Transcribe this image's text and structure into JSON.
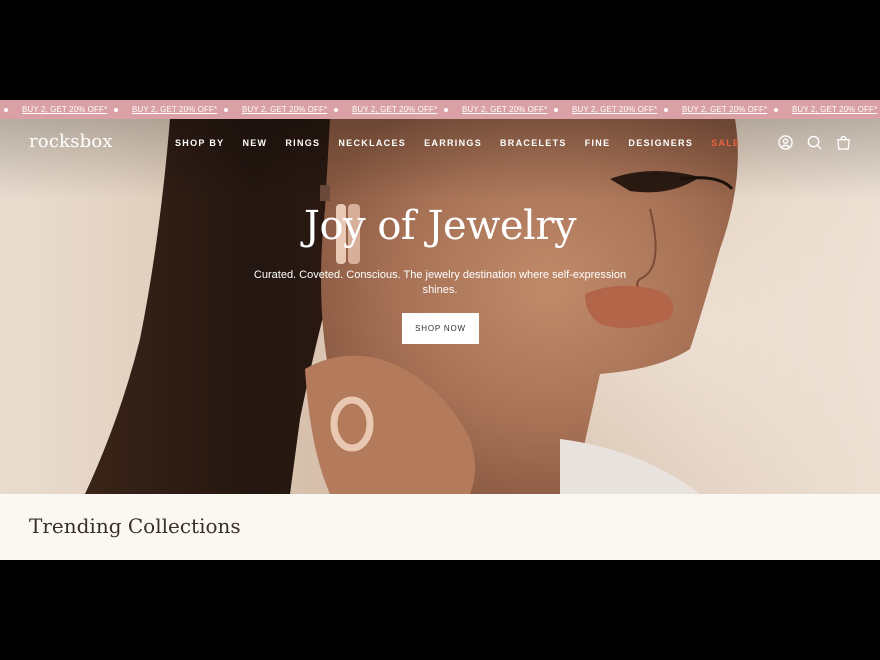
{
  "promo_bar": {
    "items": [
      "BUY 2, GET 20% OFF*",
      "BUY 2, GET 20% OFF*",
      "BUY 2, GET 20% OFF*",
      "BUY 2, GET 20% OFF*",
      "BUY 2, GET 20% OFF*",
      "BUY 2, GET 20% OFF*",
      "BUY 2, GET 20% OFF*",
      "BUY 2, GET 20% OFF*"
    ]
  },
  "header": {
    "logo": "rocksbox",
    "nav": [
      "SHOP BY",
      "NEW",
      "RINGS",
      "NECKLACES",
      "EARRINGS",
      "BRACELETS",
      "FINE",
      "DESIGNERS",
      "SALE"
    ],
    "icons": [
      "account-icon",
      "search-icon",
      "cart-icon"
    ]
  },
  "hero": {
    "title": "Joy of Jewelry",
    "subtitle": "Curated. Coveted. Conscious. The jewelry destination where self-expression shines.",
    "cta_label": "SHOP NOW"
  },
  "trending": {
    "title": "Trending Collections"
  },
  "colors": {
    "promo_bg": "#d9a0a6",
    "sale": "#e8623f",
    "section_bg": "#fbf7f2"
  }
}
